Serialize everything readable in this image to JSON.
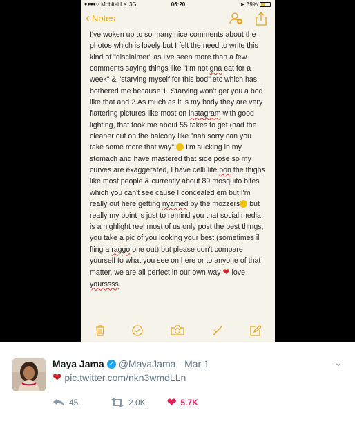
{
  "statusbar": {
    "carrier": "Mobitel LK",
    "network": "3G",
    "time": "06:20",
    "battery": "39%",
    "battery_level": 0.39
  },
  "navbar": {
    "back_label": "Notes"
  },
  "note": {
    "p1": "I've woken up to so many nice comments about the photos which is lovely but I felt the need to write this kind of \"disclaimer\" as I've seen more than a few comments saying things like \"I'm not ",
    "w_gna": "gna",
    "p2": " eat for a week\" & \"starving myself for this bod\" etc which has bothered me because 1. Starving won't get you a bod like that and 2.As much as it is my body they are very flattering pictures like most on ",
    "w_instagram": "instagram",
    "p3": " with good lighting, that took me about 55 takes to get (had the cleaner out on the balcony like \"nah sorry can you take some more that way\" ",
    "p4": " I'm sucking in my stomach and have mastered that side pose so my curves are exaggerated, I have cellulite ",
    "w_pon": "pon",
    "p5": " the thighs like most people & currently about 89 mosquito bites which you can't see cause I concealed em but I'm really out here getting ",
    "w_nyamed": "nyamed",
    "p6": " by the mozzers",
    "p7": " but really my point is just to remind you that social media is a highlight reel most of us only post the best things, you take a pic of you looking your best (sometimes il fling a ",
    "w_raggo": "raggo",
    "p8": " one out) but please don't compare yourself to what you see on here or to anyone of that matter, we are all perfect in our own way ",
    "p9": " love ",
    "w_yours": "yourssss",
    "p10": "."
  },
  "tweet": {
    "name": "Maya Jama",
    "handle": "@MayaJama",
    "sep": "·",
    "date": "Mar 1",
    "link": "pic.twitter.com/nkn3wmdLLn",
    "replies": "45",
    "retweets": "2.0K",
    "likes": "5.7K"
  },
  "colors": {
    "accent": "#e4a51c",
    "note_bg": "#f5f3ea",
    "like": "#e0245e",
    "verified": "#1da1f2"
  },
  "icons": [
    "back-chevron-icon",
    "add-person-icon",
    "share-icon",
    "trash-icon",
    "checklist-icon",
    "camera-icon",
    "sketch-icon",
    "compose-icon",
    "verified-icon",
    "heart-icon",
    "reply-icon",
    "retweet-icon",
    "like-icon",
    "chevron-down-icon"
  ]
}
